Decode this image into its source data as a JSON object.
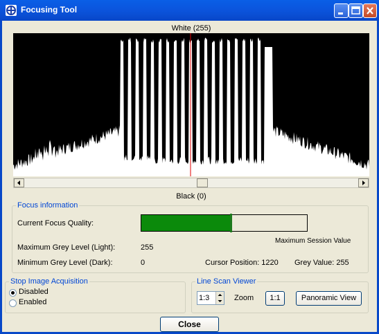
{
  "window": {
    "title": "Focusing Tool",
    "colors": {
      "titlebar": "#0a5fe6",
      "accent_group_title": "#0046d5",
      "focus_bar": "#0b8a0b"
    },
    "controls": [
      "minimize-icon",
      "maximize-icon",
      "close-icon"
    ]
  },
  "histogram": {
    "top_label": "White (255)",
    "bottom_label": "Black (0)"
  },
  "focus": {
    "group_title": "Focus information",
    "current_quality_label": "Current Focus Quality:",
    "quality_fraction": 0.54,
    "max_session_fraction": 0.54,
    "max_session_label": "Maximum Session Value",
    "max_grey_label": "Maximum Grey Level (Light):",
    "max_grey_value": "255",
    "min_grey_label": "Minimum Grey Level (Dark):",
    "min_grey_value": "0",
    "cursor_position": "Cursor Position: 1220",
    "grey_value": "Grey Value: 255"
  },
  "acquisition": {
    "group_title": "Stop Image Acquisition",
    "options": [
      "Disabled",
      "Enabled"
    ],
    "selected": "Disabled"
  },
  "line_scan": {
    "group_title": "Line Scan Viewer",
    "zoom_value": "1:3",
    "zoom_label": "Zoom",
    "one_to_one_label": "1:1",
    "panoramic_label": "Panoramic View"
  },
  "footer": {
    "close_label": "Close"
  }
}
